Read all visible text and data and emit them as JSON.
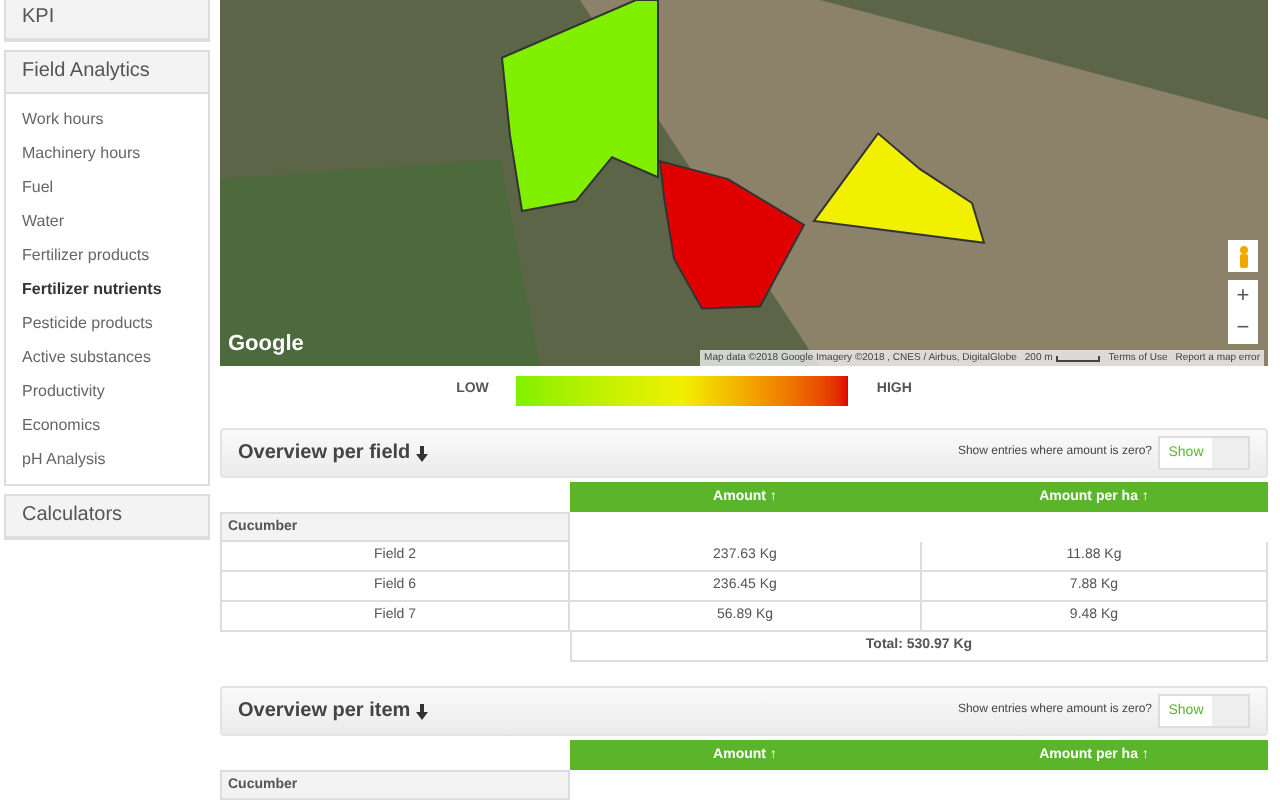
{
  "sidebar": {
    "panels": [
      {
        "title": "KPI"
      },
      {
        "title": "Field Analytics",
        "items": [
          {
            "label": "Work hours",
            "selected": false
          },
          {
            "label": "Machinery hours",
            "selected": false
          },
          {
            "label": "Fuel",
            "selected": false
          },
          {
            "label": "Water",
            "selected": false
          },
          {
            "label": "Fertilizer products",
            "selected": false
          },
          {
            "label": "Fertilizer nutrients",
            "selected": true
          },
          {
            "label": "Pesticide products",
            "selected": false
          },
          {
            "label": "Active substances",
            "selected": false
          },
          {
            "label": "Productivity",
            "selected": false
          },
          {
            "label": "Economics",
            "selected": false
          },
          {
            "label": "pH Analysis",
            "selected": false
          }
        ]
      },
      {
        "title": "Calculators"
      }
    ]
  },
  "map": {
    "fields": [
      {
        "color": "#80f000"
      },
      {
        "color": "#e00000"
      },
      {
        "color": "#f0f000"
      }
    ],
    "logo": "Google",
    "attribution": "Map data ©2018 Google Imagery ©2018 , CNES / Airbus, DigitalGlobe",
    "scale": "200 m",
    "terms": "Terms of Use",
    "report": "Report a map error",
    "zoom_in": "+",
    "zoom_out": "−"
  },
  "legend": {
    "low": "LOW",
    "high": "HIGH"
  },
  "sections": [
    {
      "title": "Overview per field",
      "prompt": "Show entries where amount is zero?",
      "toggle_label": "Show",
      "on": false,
      "columns": [
        "Amount ↑",
        "Amount per ha ↑"
      ],
      "group": "Cucumber",
      "rows": [
        {
          "name": "Field 2",
          "amount": "237.63 Kg",
          "per_ha": "11.88 Kg"
        },
        {
          "name": "Field 6",
          "amount": "236.45 Kg",
          "per_ha": "7.88 Kg"
        },
        {
          "name": "Field 7",
          "amount": "56.89 Kg",
          "per_ha": "9.48 Kg"
        }
      ],
      "total": "Total: 530.97 Kg"
    },
    {
      "title": "Overview per item",
      "prompt": "Show entries where amount is zero?",
      "toggle_label": "Show",
      "on": false,
      "columns": [
        "Amount ↑",
        "Amount per ha ↑"
      ],
      "group": "Cucumber"
    }
  ]
}
